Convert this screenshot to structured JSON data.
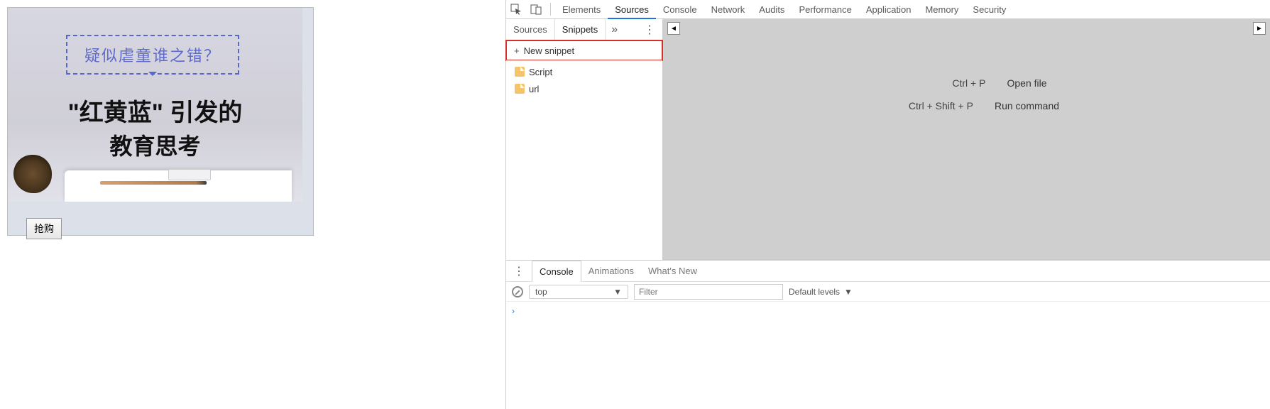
{
  "webpage": {
    "callout": "疑似虐童谁之错？",
    "title_line1": "\"红黄蓝\" 引发的",
    "title_line2": "教育思考",
    "buy_button": "抢购"
  },
  "devtools": {
    "main_tabs": [
      "Elements",
      "Sources",
      "Console",
      "Network",
      "Audits",
      "Performance",
      "Application",
      "Memory",
      "Security"
    ],
    "main_active_index": 1,
    "sources_sidebar": {
      "tabs": [
        "Sources",
        "Snippets"
      ],
      "active_index": 1,
      "new_snippet_label": "New snippet",
      "files": [
        "Script",
        "url"
      ]
    },
    "sources_main": {
      "shortcuts": [
        {
          "keys": "Ctrl + P",
          "action": "Open file"
        },
        {
          "keys": "Ctrl + Shift + P",
          "action": "Run command"
        }
      ]
    },
    "drawer": {
      "tabs": [
        "Console",
        "Animations",
        "What's New"
      ],
      "active_index": 0,
      "context": "top",
      "filter_placeholder": "Filter",
      "levels_label": "Default levels"
    }
  }
}
